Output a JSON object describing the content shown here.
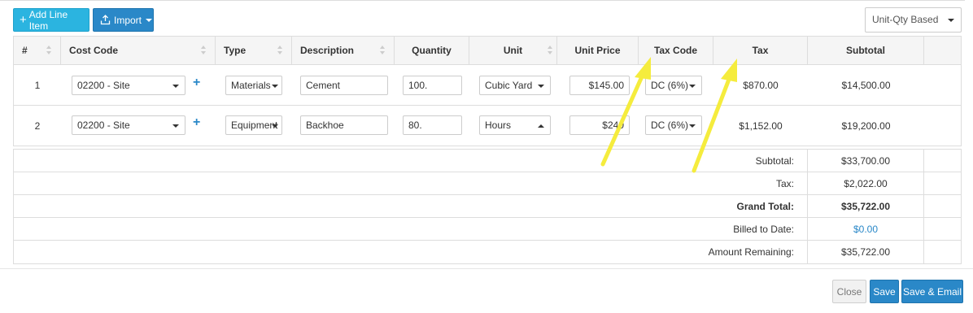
{
  "toolbar": {
    "add_line_item": "Add Line Item",
    "import": "Import",
    "mode_select": "Unit-Qty Based"
  },
  "table": {
    "headers": {
      "num": "#",
      "cost_code": "Cost Code",
      "type": "Type",
      "description": "Description",
      "quantity": "Quantity",
      "unit": "Unit",
      "unit_price": "Unit Price",
      "tax_code": "Tax Code",
      "tax": "Tax",
      "subtotal": "Subtotal"
    },
    "rows": [
      {
        "num": "1",
        "cost_code": "02200 - Site",
        "type": "Materials",
        "description": "Cement",
        "quantity": "100.",
        "unit": "Cubic Yard",
        "unit_price": "$145.00",
        "tax_code": "DC (6%)",
        "tax": "$870.00",
        "subtotal": "$14,500.00"
      },
      {
        "num": "2",
        "cost_code": "02200 - Site",
        "type": "Equipment",
        "description": "Backhoe",
        "quantity": "80.",
        "unit": "Hours",
        "unit_price": "$240",
        "tax_code": "DC (6%)",
        "tax": "$1,152.00",
        "subtotal": "$19,200.00"
      }
    ]
  },
  "totals": {
    "subtotal_label": "Subtotal:",
    "subtotal_value": "$33,700.00",
    "tax_label": "Tax:",
    "tax_value": "$2,022.00",
    "grand_total_label": "Grand Total:",
    "grand_total_value": "$35,722.00",
    "billed_label": "Billed to Date:",
    "billed_value": "$0.00",
    "remaining_label": "Amount Remaining:",
    "remaining_value": "$35,722.00"
  },
  "footer": {
    "close": "Close",
    "save": "Save",
    "save_email": "Save & Email"
  },
  "colors": {
    "primary": "#2a88c8",
    "add_button": "#2bb4e0",
    "annotation_arrow": "#f5ec3d"
  }
}
